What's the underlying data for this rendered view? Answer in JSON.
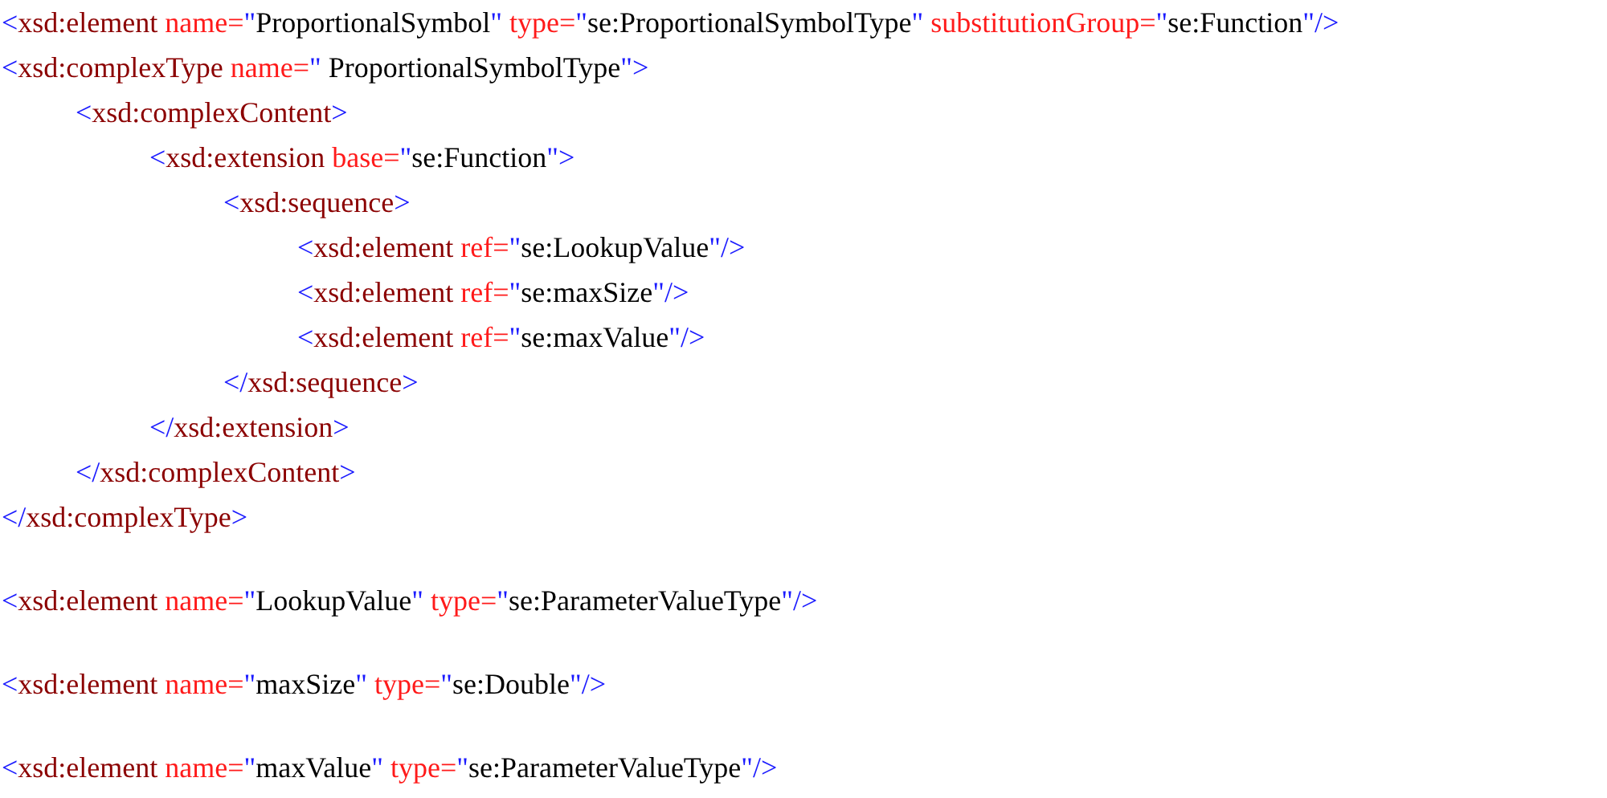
{
  "groups": [
    [
      {
        "tokens": [
          {
            "kind": "punct",
            "text": "<"
          },
          {
            "kind": "tag",
            "text": "xsd:element"
          },
          {
            "kind": "attr",
            "text": " name="
          },
          {
            "kind": "punct",
            "text": "\""
          },
          {
            "kind": "value",
            "text": "ProportionalSymbol"
          },
          {
            "kind": "punct",
            "text": "\""
          },
          {
            "kind": "attr",
            "text": " type="
          },
          {
            "kind": "punct",
            "text": "\""
          },
          {
            "kind": "value",
            "text": "se:ProportionalSymbolType"
          },
          {
            "kind": "punct",
            "text": "\""
          },
          {
            "kind": "attr",
            "text": " substitutionGroup="
          },
          {
            "kind": "punct",
            "text": "\""
          },
          {
            "kind": "value",
            "text": "se:Function"
          },
          {
            "kind": "punct",
            "text": "\"/>"
          }
        ]
      },
      {
        "tokens": [
          {
            "kind": "punct",
            "text": "<"
          },
          {
            "kind": "tag",
            "text": "xsd:complexType"
          },
          {
            "kind": "attr",
            "text": " name="
          },
          {
            "kind": "punct",
            "text": "\""
          },
          {
            "kind": "value",
            "text": " ProportionalSymbolType"
          },
          {
            "kind": "punct",
            "text": "\">"
          }
        ],
        "children": [
          {
            "tokens": [
              {
                "kind": "punct",
                "text": "<"
              },
              {
                "kind": "tag",
                "text": "xsd:complexContent"
              },
              {
                "kind": "punct",
                "text": ">"
              }
            ],
            "children": [
              {
                "tokens": [
                  {
                    "kind": "punct",
                    "text": "<"
                  },
                  {
                    "kind": "tag",
                    "text": "xsd:extension"
                  },
                  {
                    "kind": "attr",
                    "text": " base="
                  },
                  {
                    "kind": "punct",
                    "text": "\""
                  },
                  {
                    "kind": "value",
                    "text": "se:Function"
                  },
                  {
                    "kind": "punct",
                    "text": "\">"
                  }
                ],
                "children": [
                  {
                    "tokens": [
                      {
                        "kind": "punct",
                        "text": "<"
                      },
                      {
                        "kind": "tag",
                        "text": "xsd:sequence"
                      },
                      {
                        "kind": "punct",
                        "text": ">"
                      }
                    ],
                    "children": [
                      {
                        "tokens": [
                          {
                            "kind": "punct",
                            "text": "<"
                          },
                          {
                            "kind": "tag",
                            "text": "xsd:element"
                          },
                          {
                            "kind": "attr",
                            "text": " ref="
                          },
                          {
                            "kind": "punct",
                            "text": "\""
                          },
                          {
                            "kind": "value",
                            "text": "se:LookupValue"
                          },
                          {
                            "kind": "punct",
                            "text": "\"/>"
                          }
                        ]
                      },
                      {
                        "tokens": [
                          {
                            "kind": "punct",
                            "text": "<"
                          },
                          {
                            "kind": "tag",
                            "text": "xsd:element"
                          },
                          {
                            "kind": "attr",
                            "text": " ref="
                          },
                          {
                            "kind": "punct",
                            "text": "\""
                          },
                          {
                            "kind": "value",
                            "text": "se:maxSize"
                          },
                          {
                            "kind": "punct",
                            "text": "\"/>"
                          }
                        ]
                      },
                      {
                        "tokens": [
                          {
                            "kind": "punct",
                            "text": "<"
                          },
                          {
                            "kind": "tag",
                            "text": "xsd:element"
                          },
                          {
                            "kind": "attr",
                            "text": " ref="
                          },
                          {
                            "kind": "punct",
                            "text": "\""
                          },
                          {
                            "kind": "value",
                            "text": "se:maxValue"
                          },
                          {
                            "kind": "punct",
                            "text": "\"/>"
                          }
                        ]
                      }
                    ],
                    "close": [
                      {
                        "kind": "punct",
                        "text": "</"
                      },
                      {
                        "kind": "tag",
                        "text": "xsd:sequence"
                      },
                      {
                        "kind": "punct",
                        "text": ">"
                      }
                    ]
                  }
                ],
                "close": [
                  {
                    "kind": "punct",
                    "text": "</"
                  },
                  {
                    "kind": "tag",
                    "text": "xsd:extension"
                  },
                  {
                    "kind": "punct",
                    "text": ">"
                  }
                ]
              }
            ],
            "close": [
              {
                "kind": "punct",
                "text": "</"
              },
              {
                "kind": "tag",
                "text": "xsd:complexContent"
              },
              {
                "kind": "punct",
                "text": ">"
              }
            ]
          }
        ],
        "close": [
          {
            "kind": "punct",
            "text": "</"
          },
          {
            "kind": "tag",
            "text": "xsd:complexType"
          },
          {
            "kind": "punct",
            "text": ">"
          }
        ]
      }
    ],
    [
      {
        "tokens": [
          {
            "kind": "punct",
            "text": "<"
          },
          {
            "kind": "tag",
            "text": "xsd:element"
          },
          {
            "kind": "attr",
            "text": " name="
          },
          {
            "kind": "punct",
            "text": "\""
          },
          {
            "kind": "value",
            "text": "LookupValue"
          },
          {
            "kind": "punct",
            "text": "\""
          },
          {
            "kind": "attr",
            "text": " type="
          },
          {
            "kind": "punct",
            "text": "\""
          },
          {
            "kind": "value",
            "text": "se:ParameterValueType"
          },
          {
            "kind": "punct",
            "text": "\"/>"
          }
        ]
      }
    ],
    [
      {
        "tokens": [
          {
            "kind": "punct",
            "text": "<"
          },
          {
            "kind": "tag",
            "text": "xsd:element"
          },
          {
            "kind": "attr",
            "text": " name="
          },
          {
            "kind": "punct",
            "text": "\""
          },
          {
            "kind": "value",
            "text": "maxSize"
          },
          {
            "kind": "punct",
            "text": "\""
          },
          {
            "kind": "attr",
            "text": " type="
          },
          {
            "kind": "punct",
            "text": "\""
          },
          {
            "kind": "value",
            "text": "se:Double"
          },
          {
            "kind": "punct",
            "text": "\"/>"
          }
        ]
      }
    ],
    [
      {
        "tokens": [
          {
            "kind": "punct",
            "text": "<"
          },
          {
            "kind": "tag",
            "text": "xsd:element"
          },
          {
            "kind": "attr",
            "text": " name="
          },
          {
            "kind": "punct",
            "text": "\""
          },
          {
            "kind": "value",
            "text": "maxValue"
          },
          {
            "kind": "punct",
            "text": "\""
          },
          {
            "kind": "attr",
            "text": " type="
          },
          {
            "kind": "punct",
            "text": "\""
          },
          {
            "kind": "value",
            "text": "se:ParameterValueType"
          },
          {
            "kind": "punct",
            "text": "\"/>"
          }
        ]
      }
    ]
  ]
}
